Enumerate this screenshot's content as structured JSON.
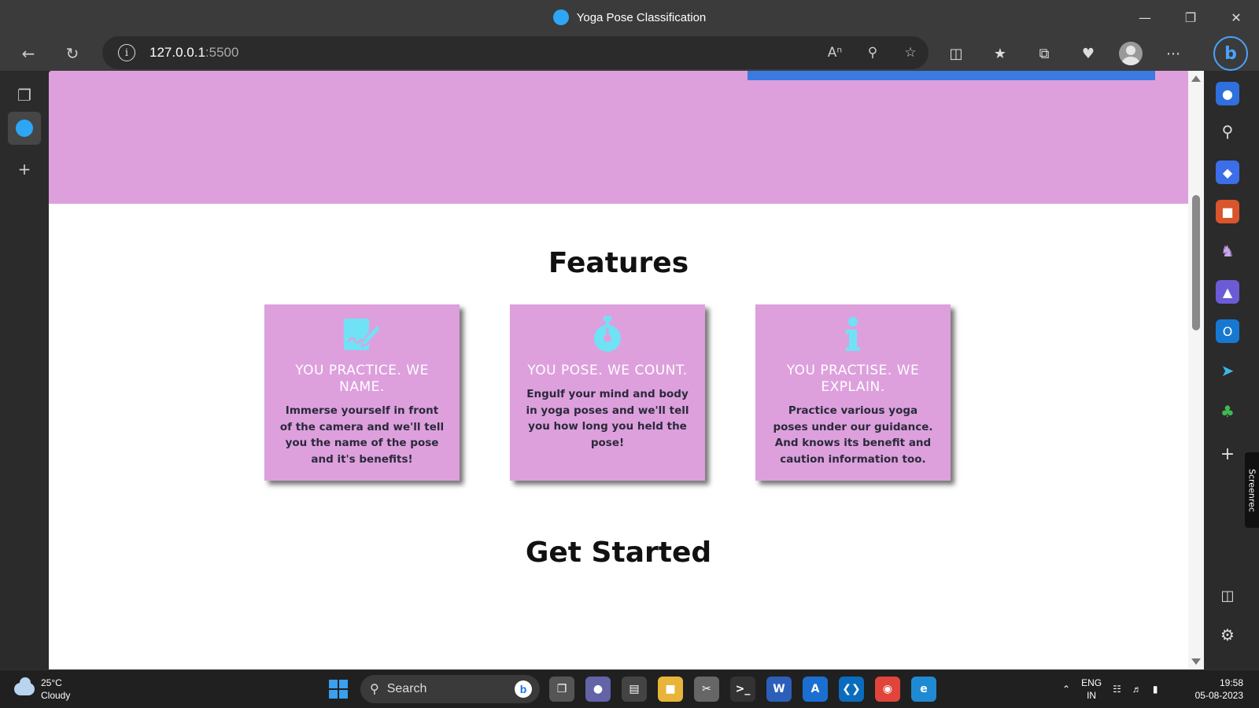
{
  "window": {
    "title": "Yoga Pose Classification"
  },
  "address": {
    "host": "127.0.0.1",
    "port": ":5500"
  },
  "page": {
    "features_title": "Features",
    "get_started_title": "Get Started",
    "cards": [
      {
        "icon": "edit-signature-icon",
        "title": "YOU PRACTICE. WE NAME.",
        "text": "Immerse yourself in front of the camera and we'll tell you the name of the pose and it's benefits!"
      },
      {
        "icon": "stopwatch-icon",
        "title": "YOU POSE. WE COUNT.",
        "text": "Engulf your mind and body in yoga poses and we'll tell you how long you held the pose!"
      },
      {
        "icon": "info-icon",
        "title": "YOU PRACTISE. WE EXPLAIN.",
        "text": "Practice various yoga poses under our guidance. And knows its benefit and caution information too."
      }
    ]
  },
  "colors": {
    "card_bg": "#dda0dd",
    "icon": "#6fe3f5",
    "accent_bar": "#3b7ae0"
  },
  "screenrec": "Screenrec",
  "taskbar": {
    "weather_temp": "25°C",
    "weather_desc": "Cloudy",
    "search_label": "Search",
    "lang_top": "ENG",
    "lang_bottom": "IN",
    "time": "19:58",
    "date": "05-08-2023"
  }
}
